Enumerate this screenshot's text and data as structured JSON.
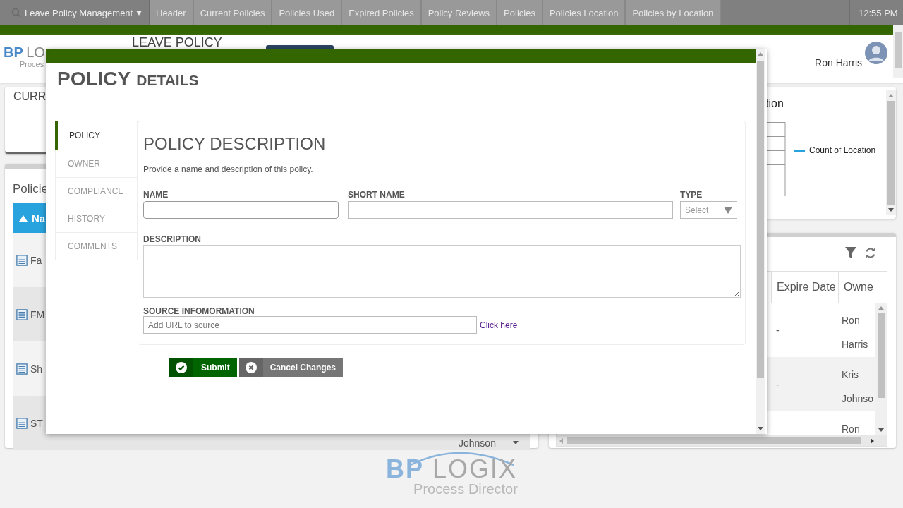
{
  "top_nav": {
    "app_menu": "Leave Policy Management",
    "tabs": [
      "Header",
      "Current Policies",
      "Policies Used",
      "Expired Policies",
      "Policy Reviews",
      "Policies",
      "Policies Location",
      "Policies by Location"
    ],
    "clock": "12:55 PM"
  },
  "header": {
    "logo_primary": "BP",
    "logo_secondary": "LO",
    "logo_subtitle": "Proces",
    "title": "LEAVE POLICY",
    "user": "Ron Harris"
  },
  "summary_card": {
    "title": "CURR"
  },
  "policies_grid": {
    "title": "Policie",
    "sort_column": "Na",
    "rows": [
      {
        "name": "Fa"
      },
      {
        "name": "FM"
      },
      {
        "name": "Sh"
      },
      {
        "name": "ST",
        "owner": "Johnson"
      }
    ]
  },
  "chart_card": {
    "title": "tion",
    "legend": [
      {
        "label": "Count of Location",
        "color": "#29a3dd"
      }
    ]
  },
  "records_grid": {
    "columns": [
      "Expire Date",
      "Owne"
    ],
    "rows": [
      {
        "expire_date": "-",
        "owner": "Ron Harris"
      },
      {
        "expire_date": "-",
        "owner": "Kris Johnso"
      },
      {
        "owner": "Ron"
      }
    ]
  },
  "modal": {
    "title_main": "POLICY",
    "title_sub": "DETAILS",
    "tabs": [
      {
        "label": "POLICY",
        "selected": true
      },
      {
        "label": "OWNER",
        "selected": false
      },
      {
        "label": "COMPLIANCE",
        "selected": false
      },
      {
        "label": "HISTORY",
        "selected": false
      },
      {
        "label": "COMMENTS",
        "selected": false
      }
    ],
    "section_title": "POLICY DESCRIPTION",
    "intro": "Provide a name and description of this policy.",
    "name_label": "NAME",
    "short_name_label": "SHORT NAME",
    "type_label": "TYPE",
    "type_placeholder": "Select",
    "description_label": "DESCRIPTION",
    "source_label": "SOURCE INFOMORMATION",
    "source_placeholder": "Add URL to source",
    "source_link": "Click here",
    "buttons": [
      {
        "kind": "submit",
        "label": "Submit"
      },
      {
        "kind": "cancel",
        "label": "Cancel Changes"
      }
    ]
  },
  "footer": {
    "logo_primary": "BP",
    "logo_secondary": "LOGIX",
    "logo_subtitle": "Process Director"
  }
}
